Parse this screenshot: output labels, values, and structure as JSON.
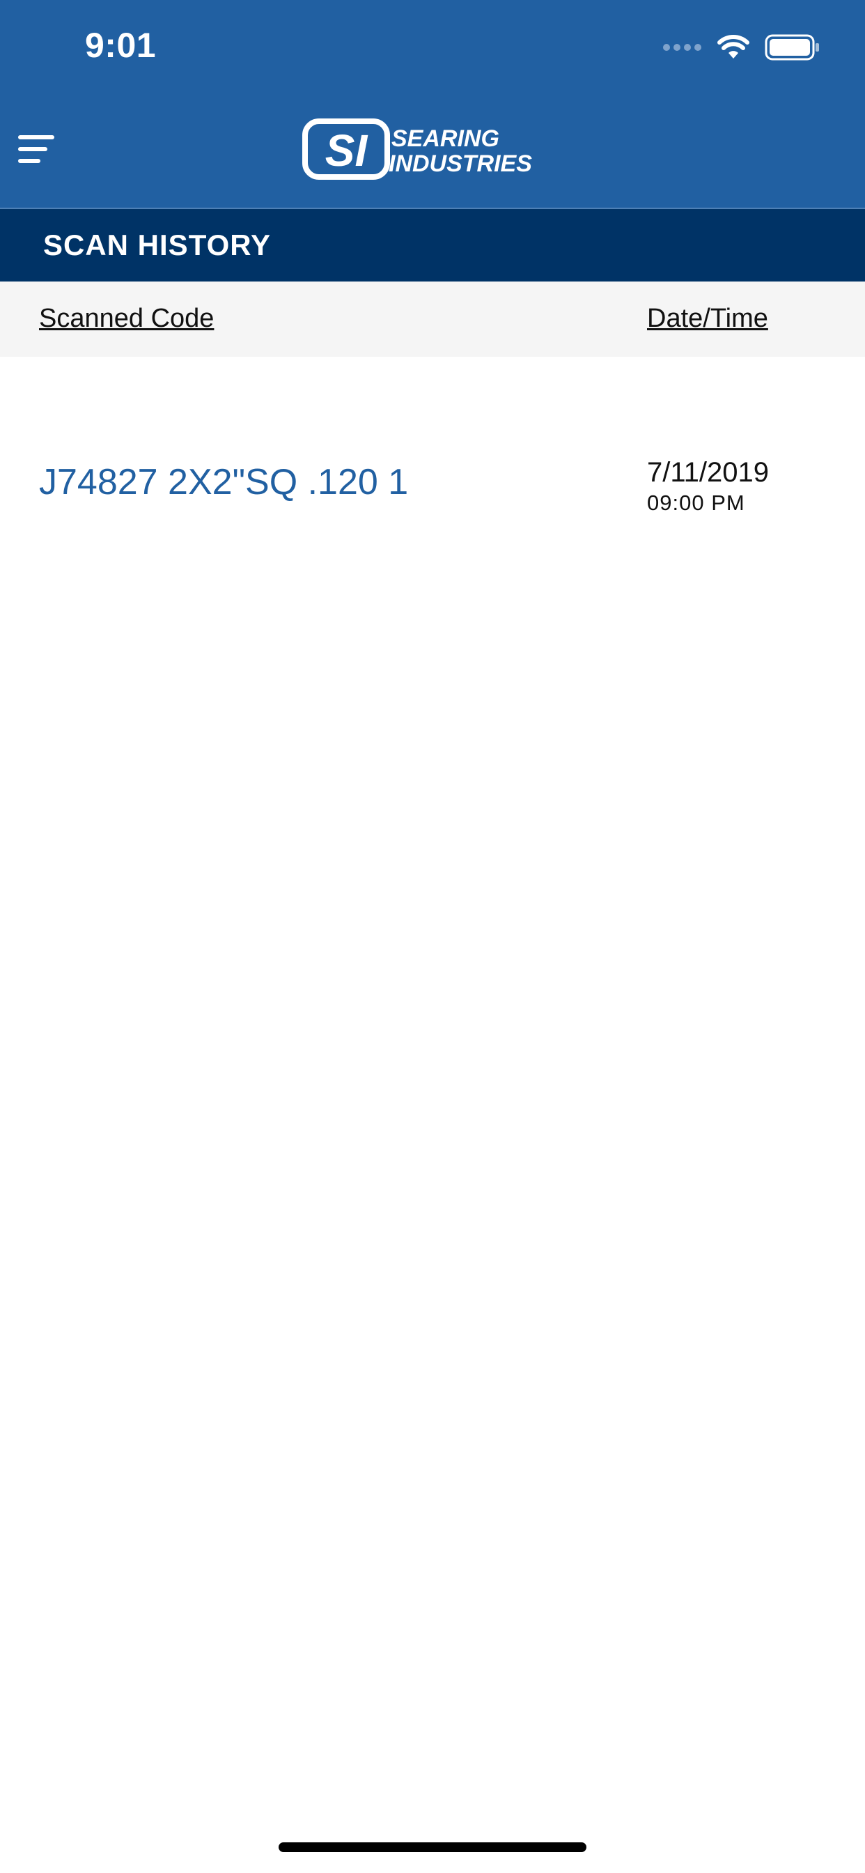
{
  "status_bar": {
    "time": "9:01",
    "icons": [
      "signal-icon",
      "wifi-icon",
      "battery-icon"
    ]
  },
  "header": {
    "menu_icon": "menu-icon",
    "logo_mark": "SI",
    "logo_line1": "SEARING",
    "logo_line2": "INDUSTRIES"
  },
  "section": {
    "title": "SCAN HISTORY"
  },
  "table": {
    "columns": [
      "Scanned Code",
      "Date/Time"
    ],
    "rows": [
      {
        "code": "J74827 2X2\"SQ .120 1",
        "date": "7/11/2019",
        "time": "09:00 PM"
      }
    ]
  },
  "colors": {
    "header_bg": "#2160a2",
    "section_bg": "#003366",
    "column_header_bg": "#f5f5f5",
    "code_text": "#2160a2"
  }
}
